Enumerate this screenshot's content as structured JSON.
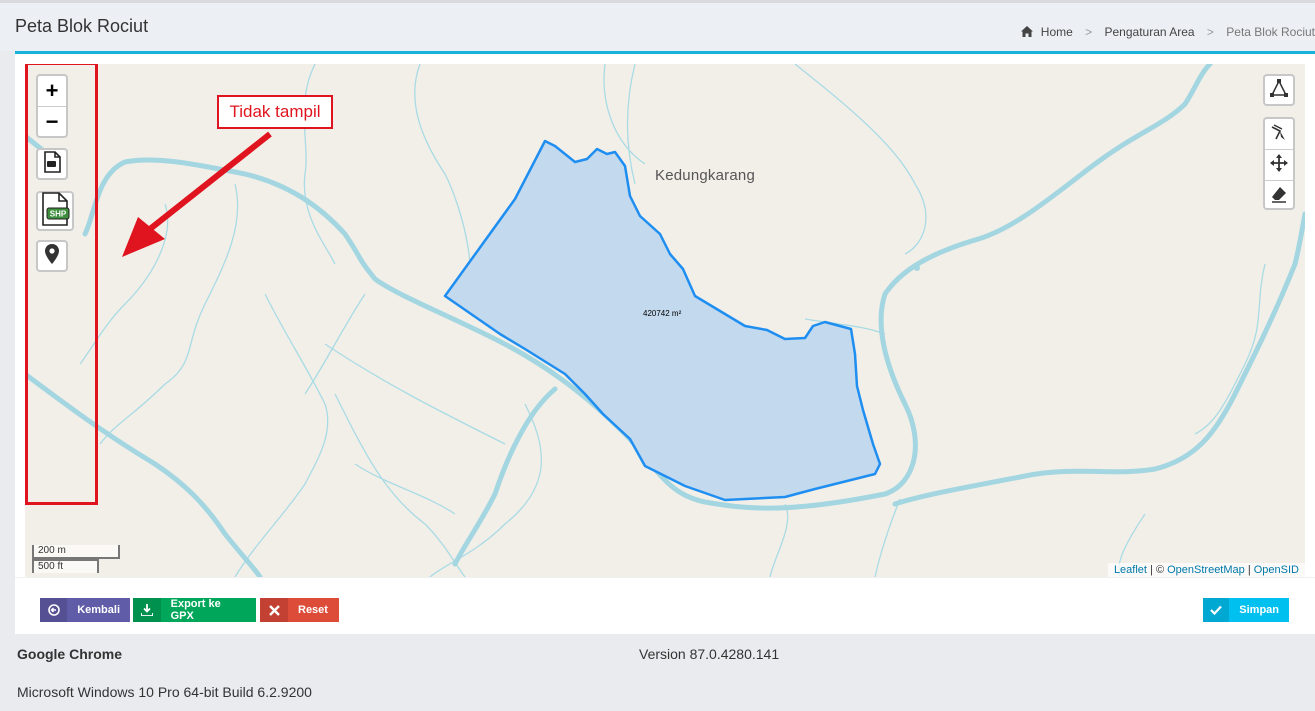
{
  "page": {
    "title": "Peta Blok Rociut"
  },
  "breadcrumb": {
    "home": "Home",
    "section": "Pengaturan Area",
    "current": "Peta Blok Rociut"
  },
  "map": {
    "place_label": "Kedungkarang",
    "area_label": "420742 m²",
    "annotation": "Tidak tampil",
    "scale_metric": "200 m",
    "scale_imperial": "500 ft",
    "attribution": {
      "leaflet": "Leaflet",
      "sep": " | © ",
      "osm": "OpenStreetMap",
      "sep2": " | ",
      "opensid": "OpenSID"
    },
    "controls": {
      "zoom_in": "+",
      "zoom_out": "−",
      "shp_label": "SHP",
      "icons": [
        "pdf-file-icon",
        "shp-file-icon",
        "map-marker-icon",
        "draw-polygon-icon",
        "cut-icon",
        "move-icon",
        "eraser-icon"
      ]
    },
    "colors": {
      "polygon_fill": "#c2d9ee",
      "polygon_stroke": "#1f8ef1",
      "river": "#a3d6e0",
      "highlight": "#e0141e"
    }
  },
  "buttons": {
    "back": "Kembali",
    "export_gpx": "Export ke GPX",
    "reset": "Reset",
    "save": "Simpan"
  },
  "system": {
    "browser": "Google Chrome",
    "version": "Version 87.0.4280.141",
    "os": "Microsoft Windows 10 Pro 64-bit Build 6.2.9200"
  }
}
